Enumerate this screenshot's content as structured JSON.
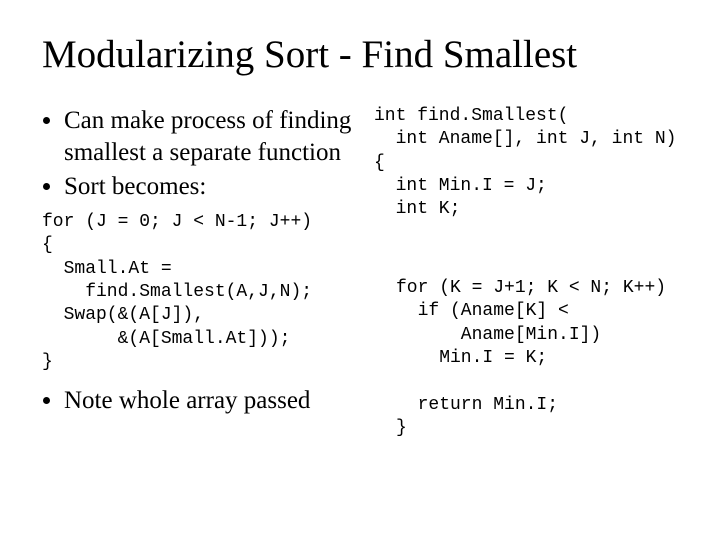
{
  "title": "Modularizing Sort - Find Smallest",
  "bullets_top": [
    "Can make process of finding smallest a separate function",
    "Sort becomes:"
  ],
  "code_right_top": "int find.Smallest(\n  int Aname[], int J, int N)\n{\n  int Min.I = J;\n  int K;",
  "code_left_bottom": "for (J = 0; J < N-1; J++)\n{\n  Small.At =\n    find.Smallest(A,J,N);\n  Swap(&(A[J]),\n       &(A[Small.At]));\n}",
  "code_right_bottom": "for (K = J+1; K < N; K++)\n  if (Aname[K] <\n      Aname[Min.I])\n    Min.I = K;\n\n  return Min.I;\n}",
  "bullets_bottom": [
    "Note whole array passed"
  ]
}
